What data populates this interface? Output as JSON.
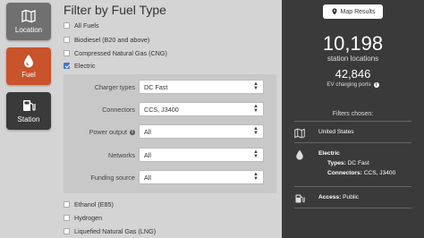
{
  "rail": {
    "location_label": "Location",
    "fuel_label": "Fuel",
    "station_label": "Station"
  },
  "main": {
    "title": "Filter by Fuel Type",
    "fuel_types": [
      {
        "label": "All Fuels",
        "checked": false
      },
      {
        "label": "Biodiesel (B20 and above)",
        "checked": false
      },
      {
        "label": "Compressed Natural Gas (CNG)",
        "checked": false
      },
      {
        "label": "Electric",
        "checked": true
      }
    ],
    "electric_options": [
      {
        "label": "Charger types",
        "value": "DC Fast",
        "info": false
      },
      {
        "label": "Connectors",
        "value": "CCS, J3400",
        "info": false
      },
      {
        "label": "Power output",
        "value": "All",
        "info": true
      },
      {
        "label": "Networks",
        "value": "All",
        "info": false
      },
      {
        "label": "Funding source",
        "value": "All",
        "info": false
      }
    ],
    "more_fuel_types": [
      {
        "label": "Ethanol (E85)",
        "checked": false
      },
      {
        "label": "Hydrogen",
        "checked": false
      },
      {
        "label": "Liquefied Natural Gas (LNG)",
        "checked": false
      }
    ]
  },
  "results": {
    "map_button_label": "Map Results",
    "station_count": "10,198",
    "station_count_label": "station locations",
    "ports_count": "42,846",
    "ports_label": "EV charging ports",
    "filters_title": "Filters chosen:",
    "location": "United States",
    "fuel_heading": "Electric",
    "types_label": "Types:",
    "types_value": "DC Fast",
    "connectors_label": "Connectors:",
    "connectors_value": "CCS, J3400",
    "access_label": "Access:",
    "access_value": "Public"
  },
  "colors": {
    "fuel_accent": "#c9532a",
    "checkbox_checked": "#4a78c8",
    "results_bg": "#3a3a3a"
  }
}
